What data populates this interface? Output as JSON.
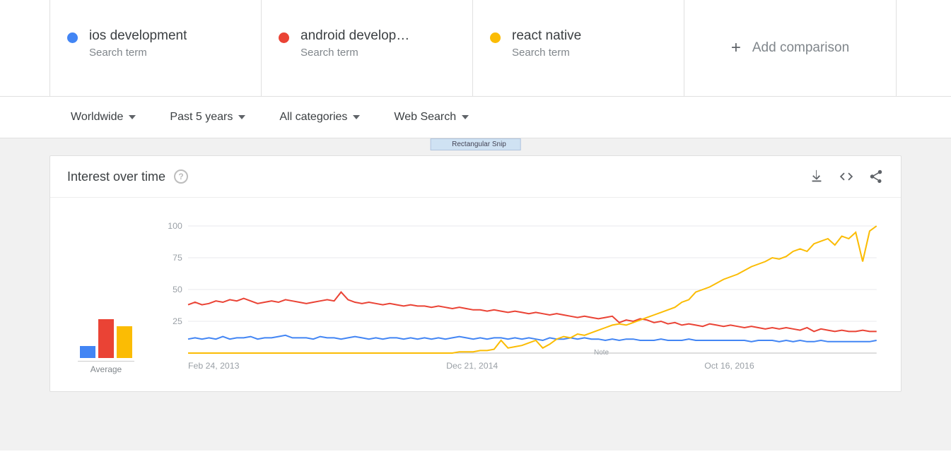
{
  "terms": [
    {
      "name": "ios development",
      "sub": "Search term",
      "color": "#4285F4"
    },
    {
      "name": "android develop…",
      "sub": "Search term",
      "color": "#EA4335"
    },
    {
      "name": "react native",
      "sub": "Search term",
      "color": "#FBBC04"
    }
  ],
  "add_comparison_label": "Add comparison",
  "filters": {
    "region": "Worldwide",
    "time": "Past 5 years",
    "category": "All categories",
    "type": "Web Search"
  },
  "snip_label": "Rectangular Snip",
  "card": {
    "title": "Interest over time",
    "average_label": "Average",
    "note_label": "Note"
  },
  "chart_data": {
    "type": "line",
    "ylim": [
      0,
      100
    ],
    "yticks": [
      25,
      50,
      75,
      100
    ],
    "x_tick_labels": [
      "Feb 24, 2013",
      "Dec 21, 2014",
      "Oct 16, 2016"
    ],
    "x_tick_positions": [
      0.0,
      0.375,
      0.75
    ],
    "averages": [
      10,
      33,
      27
    ],
    "series": [
      {
        "name": "ios development",
        "color": "#4285F4",
        "values": [
          11,
          12,
          11,
          12,
          11,
          13,
          11,
          12,
          12,
          13,
          11,
          12,
          12,
          13,
          14,
          12,
          12,
          12,
          11,
          13,
          12,
          12,
          11,
          12,
          13,
          12,
          11,
          12,
          11,
          12,
          12,
          11,
          12,
          11,
          12,
          11,
          12,
          11,
          12,
          13,
          12,
          11,
          12,
          11,
          12,
          12,
          11,
          12,
          11,
          12,
          11,
          10,
          12,
          11,
          11,
          12,
          11,
          12,
          11,
          11,
          10,
          11,
          10,
          11,
          11,
          10,
          10,
          10,
          11,
          10,
          10,
          10,
          11,
          10,
          10,
          10,
          10,
          10,
          10,
          10,
          10,
          9,
          10,
          10,
          10,
          9,
          10,
          9,
          10,
          9,
          9,
          10,
          9,
          9,
          9,
          9,
          9,
          9,
          9,
          10
        ]
      },
      {
        "name": "android development",
        "color": "#EA4335",
        "values": [
          38,
          40,
          38,
          39,
          41,
          40,
          42,
          41,
          43,
          41,
          39,
          40,
          41,
          40,
          42,
          41,
          40,
          39,
          40,
          41,
          42,
          41,
          48,
          42,
          40,
          39,
          40,
          39,
          38,
          39,
          38,
          37,
          38,
          37,
          37,
          36,
          37,
          36,
          35,
          36,
          35,
          34,
          34,
          33,
          34,
          33,
          32,
          33,
          32,
          31,
          32,
          31,
          30,
          31,
          30,
          29,
          28,
          29,
          28,
          27,
          28,
          29,
          24,
          26,
          25,
          27,
          26,
          24,
          25,
          23,
          24,
          22,
          23,
          22,
          21,
          23,
          22,
          21,
          22,
          21,
          20,
          21,
          20,
          19,
          20,
          19,
          20,
          19,
          18,
          20,
          17,
          19,
          18,
          17,
          18,
          17,
          17,
          18,
          17,
          17
        ]
      },
      {
        "name": "react native",
        "color": "#FBBC04",
        "values": [
          0,
          0,
          0,
          0,
          0,
          0,
          0,
          0,
          0,
          0,
          0,
          0,
          0,
          0,
          0,
          0,
          0,
          0,
          0,
          0,
          0,
          0,
          0,
          0,
          0,
          0,
          0,
          0,
          0,
          0,
          0,
          0,
          0,
          0,
          0,
          0,
          0,
          0,
          0,
          1,
          1,
          1,
          2,
          2,
          3,
          10,
          4,
          5,
          6,
          8,
          10,
          4,
          7,
          11,
          13,
          12,
          15,
          14,
          16,
          18,
          20,
          22,
          23,
          22,
          24,
          26,
          28,
          30,
          32,
          34,
          36,
          40,
          42,
          48,
          50,
          52,
          55,
          58,
          60,
          62,
          65,
          68,
          70,
          72,
          75,
          74,
          76,
          80,
          82,
          80,
          86,
          88,
          90,
          85,
          92,
          90,
          95,
          72,
          96,
          100
        ]
      }
    ]
  }
}
